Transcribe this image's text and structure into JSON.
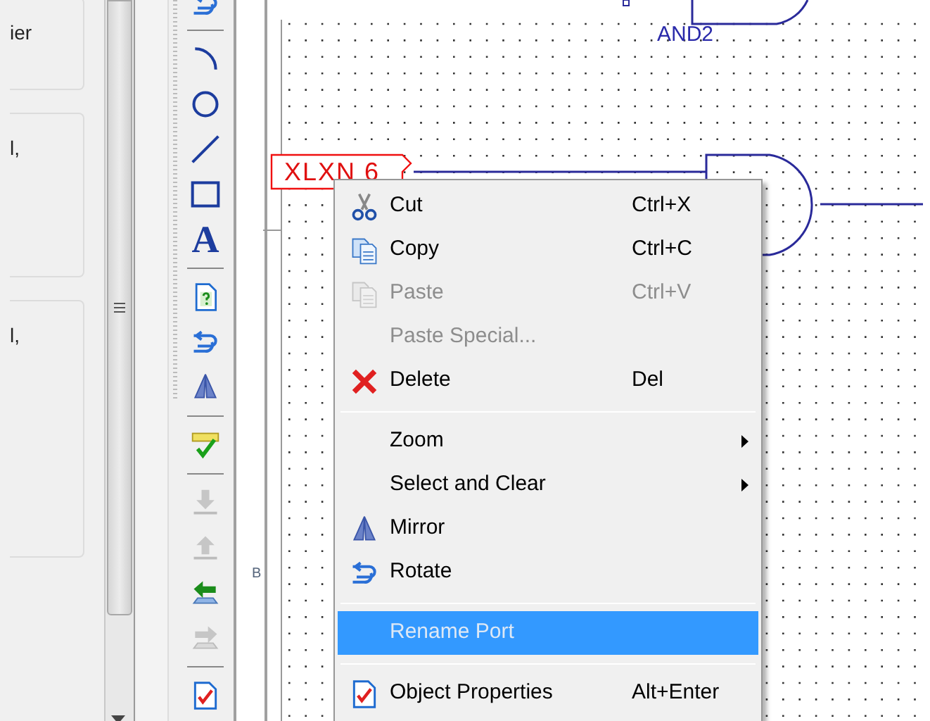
{
  "left_panel": {
    "cards": [
      {
        "text": "ier"
      },
      {
        "text": "l,"
      },
      {
        "text": "l,"
      }
    ]
  },
  "toolbar": {
    "tools": [
      {
        "kind": "rotate",
        "disabled": false
      },
      {
        "kind": "separator"
      },
      {
        "kind": "arc",
        "disabled": false
      },
      {
        "kind": "ellipse",
        "disabled": false
      },
      {
        "kind": "line",
        "disabled": false
      },
      {
        "kind": "rectangle",
        "disabled": false
      },
      {
        "kind": "glyph",
        "glyph": "A",
        "disabled": false
      },
      {
        "kind": "separator"
      },
      {
        "kind": "help-doc",
        "disabled": false
      },
      {
        "kind": "rotate",
        "disabled": false
      },
      {
        "kind": "mirror",
        "disabled": false
      },
      {
        "kind": "separator"
      },
      {
        "kind": "ruler-check",
        "disabled": false
      },
      {
        "kind": "separator"
      },
      {
        "kind": "push-down",
        "disabled": true
      },
      {
        "kind": "push-up",
        "disabled": true
      },
      {
        "kind": "arrow-left",
        "disabled": false
      },
      {
        "kind": "arrow-right",
        "disabled": true
      },
      {
        "kind": "separator"
      },
      {
        "kind": "properties",
        "disabled": false
      }
    ]
  },
  "canvas": {
    "gate_label": "AND2",
    "port_label": "XLXN 6",
    "margin_label": "B"
  },
  "menu": {
    "items": [
      {
        "kind": "item",
        "label": "Cut",
        "shortcut": "Ctrl+X",
        "disabled": false,
        "selected": false
      },
      {
        "kind": "item",
        "label": "Copy",
        "shortcut": "Ctrl+C",
        "disabled": false,
        "selected": false
      },
      {
        "kind": "item",
        "label": "Paste",
        "shortcut": "Ctrl+V",
        "disabled": true,
        "selected": false
      },
      {
        "kind": "item",
        "label": "Paste Special...",
        "disabled": true,
        "selected": false
      },
      {
        "kind": "item",
        "label": "Delete",
        "shortcut": "Del",
        "disabled": false,
        "selected": false
      },
      {
        "kind": "separator"
      },
      {
        "kind": "submenu",
        "label": "Zoom",
        "disabled": false,
        "selected": false
      },
      {
        "kind": "submenu",
        "label": "Select and Clear",
        "disabled": false,
        "selected": false
      },
      {
        "kind": "item",
        "label": "Mirror",
        "disabled": false,
        "selected": false
      },
      {
        "kind": "item",
        "label": "Rotate",
        "disabled": false,
        "selected": false
      },
      {
        "kind": "separator"
      },
      {
        "kind": "item",
        "label": "Rename Port",
        "disabled": true,
        "selected": true
      },
      {
        "kind": "separator"
      },
      {
        "kind": "item",
        "label": "Object Properties",
        "shortcut": "Alt+Enter",
        "disabled": false,
        "selected": false
      }
    ]
  }
}
